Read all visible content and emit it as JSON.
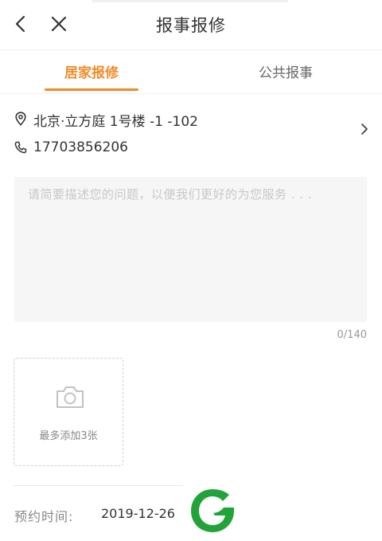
{
  "header": {
    "title": "报事报修"
  },
  "tabs": [
    {
      "label": "居家报修",
      "active": true
    },
    {
      "label": "公共报事",
      "active": false
    }
  ],
  "address": {
    "location": "北京·立方庭 1号楼 -1 -102",
    "phone": "17703856206"
  },
  "description": {
    "placeholder": "请简要描述您的问题，以便我们更好的为您服务 . . .",
    "counter": "0/140"
  },
  "photo": {
    "label": "最多添加3张"
  },
  "appointment": {
    "label": "预约时间:",
    "value": "2019-12-26"
  },
  "colors": {
    "accent": "#f08c2a",
    "logo_green": "#22a33a"
  },
  "icons": {
    "back": "back-arrow-icon",
    "close": "close-icon",
    "location": "location-pin-icon",
    "phone": "phone-icon",
    "chevron": "chevron-right-icon",
    "camera": "camera-icon",
    "logo": "brand-logo"
  }
}
